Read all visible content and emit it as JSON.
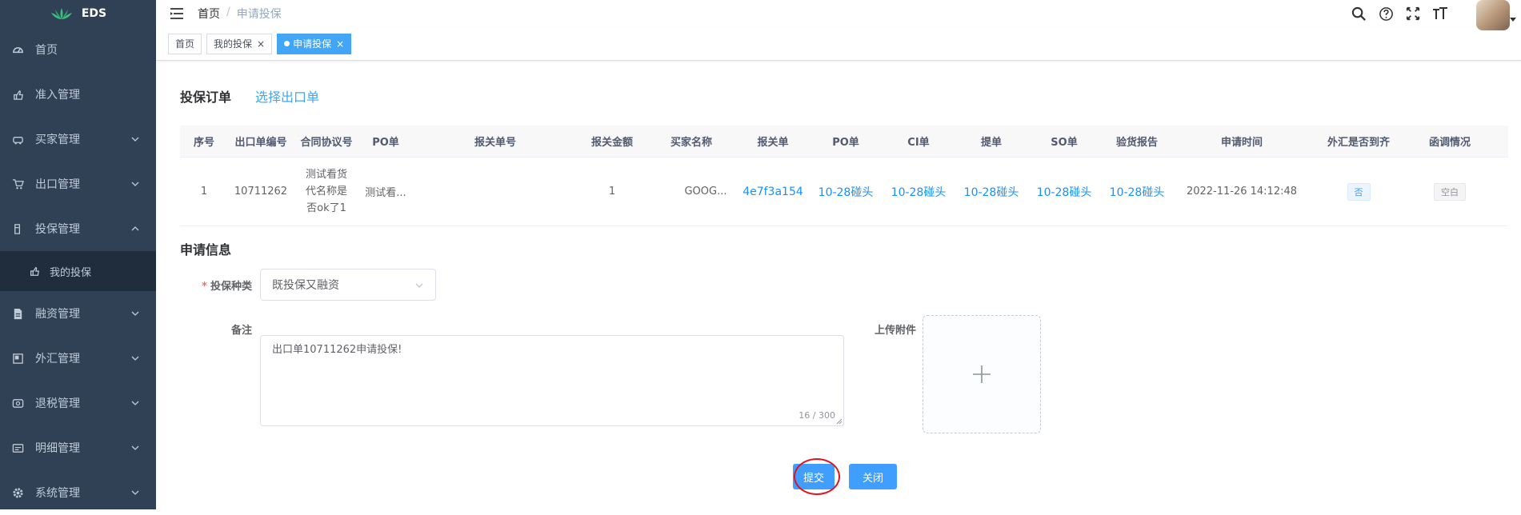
{
  "app": {
    "logo_text": "EDS"
  },
  "sidebar": {
    "items": [
      {
        "label": "首页",
        "icon": "dashboard-icon",
        "has_children": false
      },
      {
        "label": "准入管理",
        "icon": "hand-icon",
        "has_children": false
      },
      {
        "label": "买家管理",
        "icon": "car-icon",
        "has_children": true
      },
      {
        "label": "出口管理",
        "icon": "cart-icon",
        "has_children": true
      },
      {
        "label": "投保管理",
        "icon": "clipboard-icon",
        "has_children": true,
        "expanded": true
      },
      {
        "label": "融资管理",
        "icon": "document-icon",
        "has_children": true
      },
      {
        "label": "外汇管理",
        "icon": "exchange-icon",
        "has_children": true
      },
      {
        "label": "退税管理",
        "icon": "refund-icon",
        "has_children": true
      },
      {
        "label": "明细管理",
        "icon": "card-icon",
        "has_children": true
      },
      {
        "label": "系统管理",
        "icon": "gear-icon",
        "has_children": true
      }
    ],
    "sub_item": {
      "label": "我的投保",
      "icon": "hand-icon"
    }
  },
  "breadcrumb": {
    "home": "首页",
    "separator": "/",
    "current": "申请投保"
  },
  "tags": [
    {
      "label": "首页",
      "closable": false,
      "active": false
    },
    {
      "label": "我的投保",
      "closable": true,
      "active": false
    },
    {
      "label": "申请投保",
      "closable": true,
      "active": true
    }
  ],
  "order_section": {
    "title": "投保订单",
    "select_link": "选择出口单"
  },
  "table": {
    "columns": [
      "序号",
      "出口单编号",
      "合同协议号",
      "PO单",
      "报关单号",
      "报关金额",
      "买家名称",
      "报关单",
      "PO单",
      "CI单",
      "提单",
      "SO单",
      "验货报告",
      "申请时间",
      "外汇是否到齐",
      "函调情况"
    ],
    "rows": [
      {
        "index": "1",
        "export_no": "10711262",
        "contract_no": "测试看货代名称是否ok了1",
        "po": "测试看...",
        "customs_no": "",
        "customs_amount": "1",
        "buyer": "GOOG...",
        "customs_doc": "4e7f3a154",
        "po_doc": "10-28碰头",
        "ci_doc": "10-28碰头",
        "bl_doc": "10-28碰头",
        "so_doc": "10-28碰头",
        "inspection_doc": "10-28碰头",
        "apply_time": "2022-11-26 14:12:48",
        "fx_complete": "否",
        "inquiry": "空白"
      }
    ]
  },
  "apply_section": {
    "title": "申请信息",
    "type_label": "投保种类",
    "required_mark": "*",
    "type_value": "既投保又融资",
    "remark_label": "备注",
    "remark_value": "出口单10711262申请投保!",
    "word_count": "16 / 300",
    "upload_label": "上传附件"
  },
  "actions": {
    "submit": "提交",
    "close": "关闭"
  },
  "colors": {
    "sidebar_bg": "#304156",
    "primary": "#409eff",
    "active_tag": "#42a5f5",
    "highlight_ring": "#e0141e"
  }
}
